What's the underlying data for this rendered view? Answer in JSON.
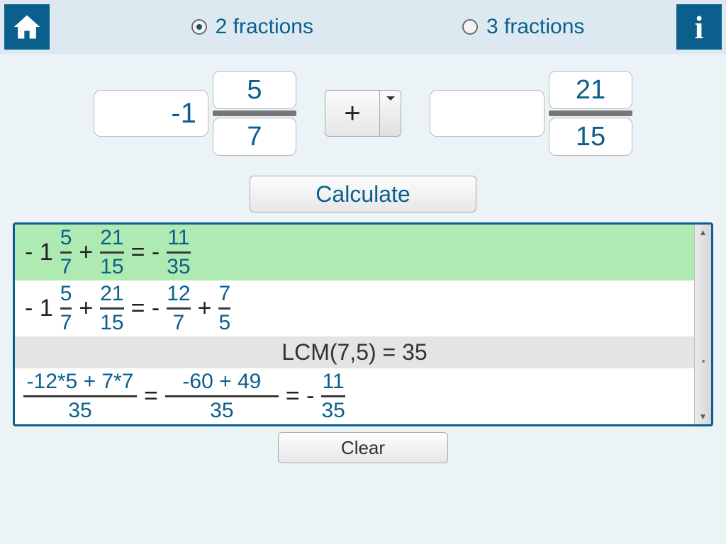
{
  "topbar": {
    "opt2": "2 fractions",
    "opt3": "3 fractions",
    "selected": "2"
  },
  "inputs": {
    "whole1": "-1",
    "num1": "5",
    "den1": "7",
    "op": "+",
    "whole2": "",
    "num2": "21",
    "den2": "15"
  },
  "buttons": {
    "calculate": "Calculate",
    "clear": "Clear"
  },
  "results": {
    "line1": {
      "lead": "- 1",
      "f1n": "5",
      "f1d": "7",
      "op": "+",
      "f2n": "21",
      "f2d": "15",
      "eq": "= -",
      "rn": "11",
      "rd": "35"
    },
    "line2": {
      "lead": "- 1",
      "f1n": "5",
      "f1d": "7",
      "op": "+",
      "f2n": "21",
      "f2d": "15",
      "eq": "= -",
      "r1n": "12",
      "r1d": "7",
      "op2": "+",
      "r2n": "7",
      "r2d": "5"
    },
    "lcm": "LCM(7,5) = 35",
    "line3": {
      "f1n": "-12*5 + 7*7",
      "f1d": "35",
      "eq1": "=",
      "f2n": "-60 + 49",
      "f2d": "35",
      "eq2": "= -",
      "rn": "11",
      "rd": "35"
    }
  }
}
